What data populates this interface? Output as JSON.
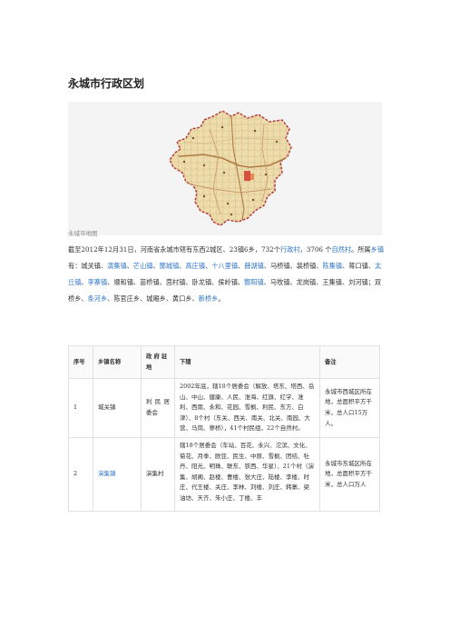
{
  "title": "永城市行政区划",
  "map_caption": "永城市地图",
  "intro": {
    "t1": "截至2012年12月31日，河南省永城市辖有东西2城区、23镇6乡，732",
    "t2": "个",
    "village_link": "行政村",
    "t3": "，3706 个",
    "natural_link": "自然村",
    "t4": "。所属",
    "town_link": "乡镇",
    "t5": "有：城关镇、",
    "towns_a": [
      "演集镇",
      "芒山镇",
      "酂城镇",
      "高庄镇",
      "十八里镇",
      "薛湖镇"
    ],
    "t6": "、马桥镇、裴桥镇、",
    "town_chenji": "陈集镇",
    "t7": "、蒋口镇、",
    "town_taiqiu": "太丘镇",
    "t8": "、",
    "town_lizhai": "李寨镇",
    "t9": "、顺和镇、苗桥镇、茴村镇、卧龙镇、侯岭镇、",
    "town_cuoyang": "酂阳镇",
    "t10": "、马牧镇、龙岗镇、王集镇、刘河镇；双桥乡、",
    "town_tiaohe": "条河乡",
    "t11": "、陈官庄乡、城厢乡、黄口乡、",
    "town_xinqiao": "新桥乡",
    "t12": "。"
  },
  "table": {
    "headers": [
      "序号",
      "乡镇名称",
      "政 府 驻地",
      "下辖",
      "备注"
    ],
    "rows": [
      {
        "no": "1",
        "name": "城关镇",
        "seat": "利 民 居委会",
        "sub": "2002年底，辖18个居委会（解放、塔东、塔西、岳山、中山、健康、人民、淮海、红旗、红学、淮利、西南、永和、花园、雪枫、利民、东方、白津）、8个村（东关、西关、南关、北关、南园、大营、马岗、蓼桥），41个村民组，22个自然村。",
        "note": "永城市西城区所在地，总面积平方千米，总人口15万人。"
      },
      {
        "no": "2",
        "name": "演集镇",
        "seat": "演集村",
        "sub": "辖18个居委会（车站、百花、永兴、沱滨、文化、菊花、月季、欧亚、民生、中原、雪枫、团结、牡丹、阳光、明珠、联东、铁西、华星）、21个村（演集、胡阁、赵楼、曹楼、张大庄、陆楼、李楼、时庄、代王楼、关庄、李林、刘楼、刘庄、韩寨、梁油坊、天齐、朱小庄、丁楼、丰",
        "note": "永城市东城区所在地，总面积平方千米，总人口万人"
      }
    ]
  }
}
